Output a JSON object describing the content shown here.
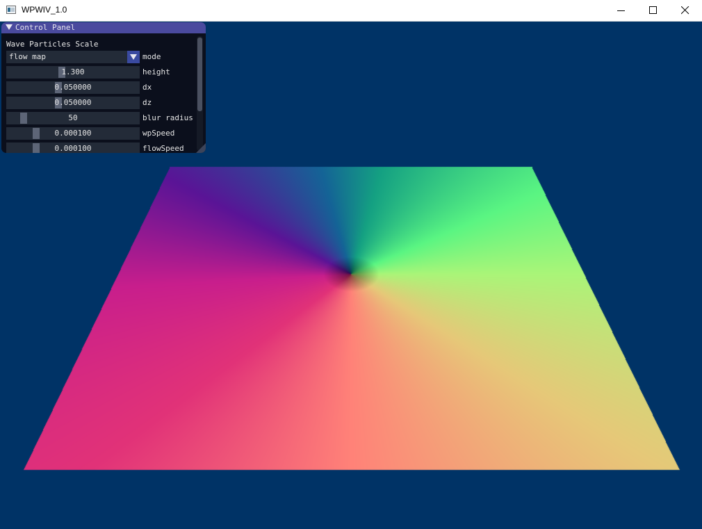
{
  "window": {
    "title": "WPWIV_1.0",
    "minimize_icon": "minimize-icon",
    "maximize_icon": "maximize-icon",
    "close_icon": "close-icon"
  },
  "viewport": {
    "background_color": "#003366"
  },
  "panel": {
    "title": "Control Panel",
    "section_title": "Wave Particles Scale",
    "mode": {
      "value": "flow map",
      "label": "mode"
    },
    "sliders": [
      {
        "value": "1.300",
        "label": "height",
        "fill": 0.41
      },
      {
        "value": "0.050000",
        "label": "dx",
        "fill": 0.38
      },
      {
        "value": "0.050000",
        "label": "dz",
        "fill": 0.38
      },
      {
        "value": "50",
        "label": "blur radius",
        "fill": 0.1
      },
      {
        "value": "0.000100",
        "label": "wpSpeed",
        "fill": 0.2
      },
      {
        "value": "0.000100",
        "label": "flowSpeed",
        "fill": 0.2
      }
    ]
  }
}
